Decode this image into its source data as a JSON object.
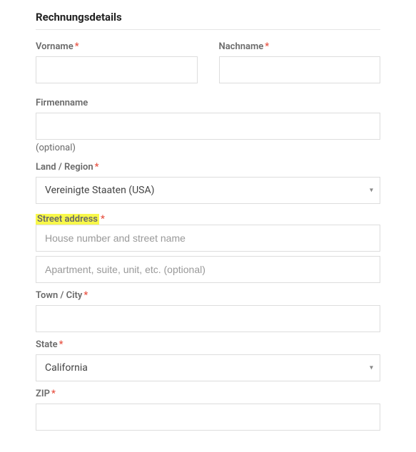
{
  "heading": "Rechnungsdetails",
  "asterisk": "*",
  "fields": {
    "firstname": {
      "label": "Vorname",
      "value": ""
    },
    "lastname": {
      "label": "Nachname",
      "value": ""
    },
    "company": {
      "label": "Firmenname",
      "optional": "(optional)",
      "value": ""
    },
    "country": {
      "label": "Land / Region",
      "selected": "Vereinigte Staaten (USA)"
    },
    "street": {
      "label": "Street address",
      "placeholder1": "House number and street name",
      "value1": "",
      "placeholder2": "Apartment, suite, unit, etc. (optional)",
      "value2": ""
    },
    "city": {
      "label": "Town / City",
      "value": ""
    },
    "state": {
      "label": "State",
      "selected": "California"
    },
    "zip": {
      "label": "ZIP",
      "value": ""
    }
  },
  "icons": {
    "chevron": "▾"
  }
}
